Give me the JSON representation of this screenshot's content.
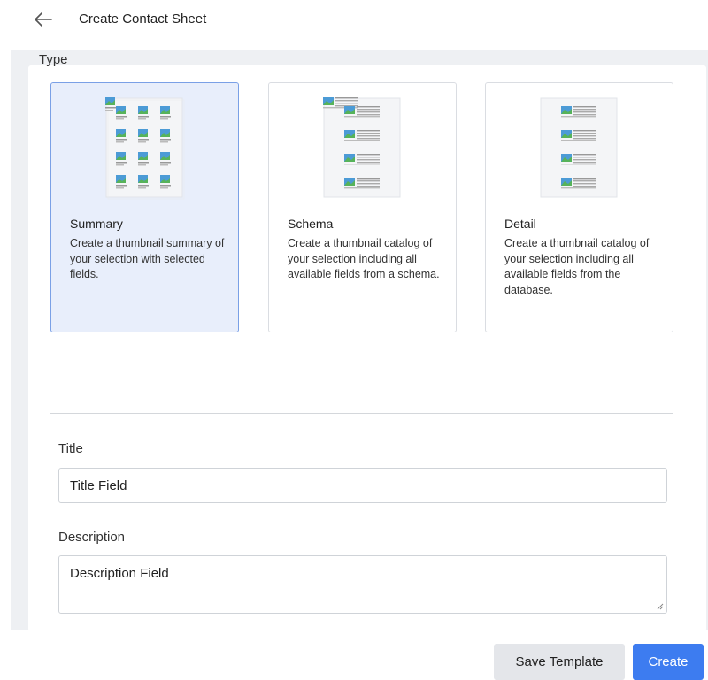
{
  "header": {
    "title": "Create Contact Sheet",
    "back_icon": "arrow-left-icon"
  },
  "type_section": {
    "label": "Type",
    "selected": "Summary",
    "options": [
      {
        "name": "Summary",
        "description": "Create a thumbnail summary of your selection with selected fields.",
        "icon": "thumbnail-grid-icon"
      },
      {
        "name": "Schema",
        "description": "Create a thumbnail catalog of your selection including all available fields from a schema.",
        "icon": "thumbnail-list-icon"
      },
      {
        "name": "Detail",
        "description": "Create a thumbnail catalog of your selection including all available fields from the database.",
        "icon": "thumbnail-list-icon"
      }
    ]
  },
  "title_field": {
    "label": "Title",
    "value": "Title Field"
  },
  "description_field": {
    "label": "Description",
    "value": "Description Field"
  },
  "actions": {
    "save_template_label": "Save Template",
    "create_label": "Create"
  },
  "colors": {
    "accent": "#3d7cf0",
    "selected_bg": "#e8eefb",
    "panel_bg": "#eef0f3"
  }
}
